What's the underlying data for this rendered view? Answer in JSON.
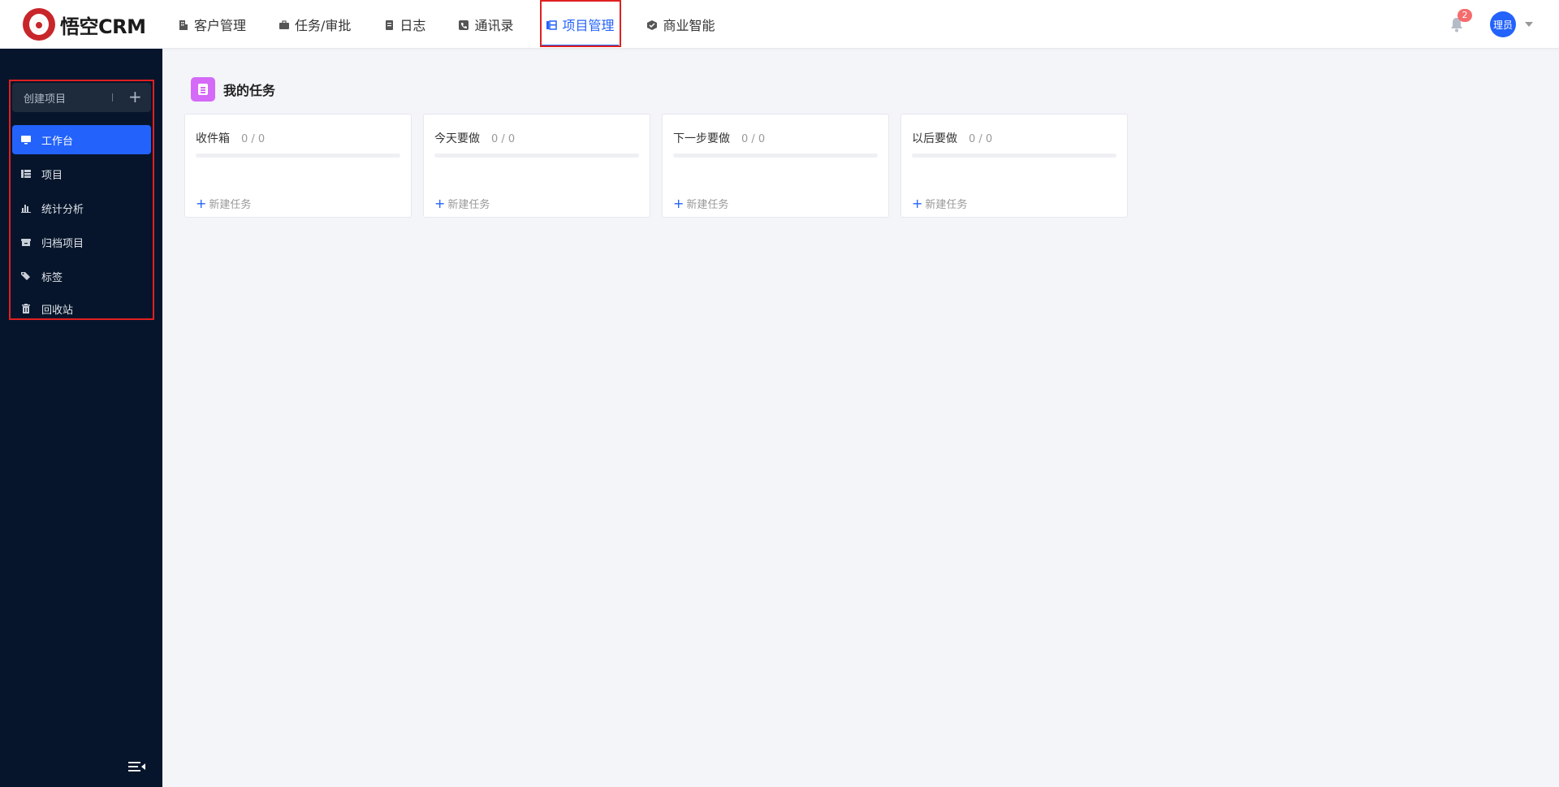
{
  "brand": {
    "name": "悟空CRM"
  },
  "nav": {
    "items": [
      {
        "label": "客户管理",
        "icon": "building-icon"
      },
      {
        "label": "任务/审批",
        "icon": "briefcase-icon"
      },
      {
        "label": "日志",
        "icon": "notebook-icon"
      },
      {
        "label": "通讯录",
        "icon": "phone-book-icon"
      },
      {
        "label": "项目管理",
        "icon": "project-icon",
        "active": true
      },
      {
        "label": "商业智能",
        "icon": "cube-icon"
      }
    ]
  },
  "header": {
    "notifications_count": "2",
    "user_label": "理员"
  },
  "sidebar": {
    "create_label": "创建项目",
    "create_plus": "+",
    "items": [
      {
        "label": "工作台",
        "icon": "monitor-icon",
        "active": true
      },
      {
        "label": "项目",
        "icon": "list-icon"
      },
      {
        "label": "统计分析",
        "icon": "bar-chart-icon"
      },
      {
        "label": "归档项目",
        "icon": "archive-icon"
      },
      {
        "label": "标签",
        "icon": "tag-icon"
      },
      {
        "label": "回收站",
        "icon": "trash-icon"
      }
    ]
  },
  "main": {
    "title": "我的任务",
    "columns": [
      {
        "title": "收件箱",
        "count": "0 / 0",
        "new_label": "新建任务"
      },
      {
        "title": "今天要做",
        "count": "0 / 0",
        "new_label": "新建任务"
      },
      {
        "title": "下一步要做",
        "count": "0 / 0",
        "new_label": "新建任务"
      },
      {
        "title": "以后要做",
        "count": "0 / 0",
        "new_label": "新建任务"
      }
    ]
  },
  "colors": {
    "accent": "#2362fb",
    "sidebar_bg": "#06152b",
    "highlight_box": "#e02020",
    "badge": "#f56c6c"
  }
}
